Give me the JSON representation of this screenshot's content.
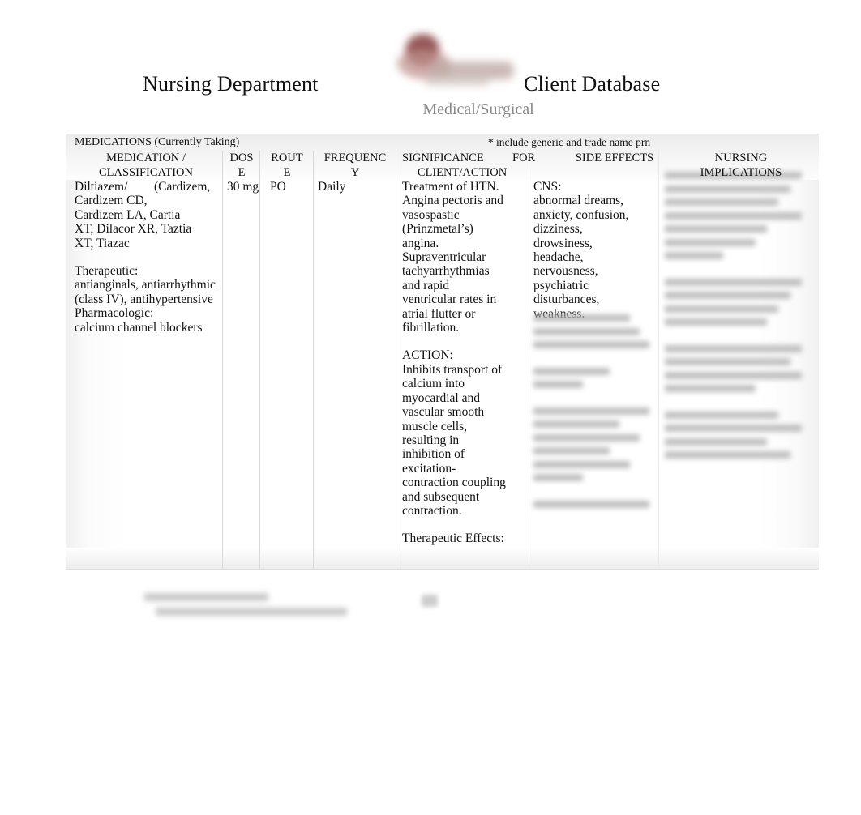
{
  "header": {
    "title_left": "Nursing Department",
    "title_right": "Client Database",
    "subtitle": "Medical/Surgical",
    "logo_name": "institution-logo-redacted"
  },
  "table": {
    "banner_label": "MEDICATIONS (Currently Taking)",
    "banner_note": "* include generic and trade name prn",
    "columns": [
      {
        "key": "medication",
        "header": "MEDICATION / CLASSIFICATION"
      },
      {
        "key": "dose",
        "header": "DOSE"
      },
      {
        "key": "route",
        "header": "ROUTE"
      },
      {
        "key": "frequency",
        "header": "FREQUENCY"
      },
      {
        "key": "significance",
        "header": "SIGNIFICANCE   FOR CLIENT/ACTION"
      },
      {
        "key": "side_effects",
        "header": "SIDE EFFECTS"
      },
      {
        "key": "nursing",
        "header": "NURSING IMPLICATIONS"
      }
    ],
    "headers": {
      "medication_l1": "MEDICATION /",
      "medication_l2": "CLASSIFICATION",
      "dose_l1": "DOS",
      "dose_l2": "E",
      "route_l1": "ROUT",
      "route_l2": "E",
      "frequency_l1": "FREQUENC",
      "frequency_l2": "Y",
      "significance_l1": "SIGNIFICANCE",
      "significance_for": "FOR",
      "significance_l2": "CLIENT/ACTION",
      "side_effects_l1": "SIDE EFFECTS",
      "nursing_l1": "NURSING",
      "nursing_l2": "IMPLICATIONS"
    },
    "row": {
      "medication_generic": "Diltiazem/",
      "medication_trade": "(Cardizem, Cardizem CD, Cardizem LA, Cartia XT, Dilacor XR, Taztia XT, Tiazac",
      "medication_therapeutic_label": "Therapeutic:",
      "medication_therapeutic_value": "antianginals, antiarrhythmic (class IV), antihypertensive",
      "medication_pharmacologic_label": "Pharmacologic:",
      "medication_pharmacologic_value": "calcium channel blockers",
      "dose": "30 mg",
      "route": "PO",
      "frequency": "Daily",
      "significance_p1": "Treatment of HTN. Angina pectoris and vasospastic (Prinzmetal’s) angina.",
      "significance_p2": "Supraventricular tachyarrhythmias and rapid ventricular rates in atrial flutter or fibrillation.",
      "significance_action_label": "ACTION:",
      "significance_action_text": "Inhibits transport of calcium into myocardial and vascular smooth muscle cells, resulting in inhibition of excitation-contraction coupling and subsequent contraction.",
      "significance_effects_label": "Therapeutic Effects:",
      "side_effects_cns_label": "CNS:",
      "side_effects_cns_text": "abnormal dreams, anxiety, confusion, dizziness, drowsiness,",
      "side_effects_cns_text2": "headache, nervousness, psychiatric disturbances, weakness.",
      "side_effects_redacted": "[redacted]",
      "nursing_redacted": "[redacted]"
    }
  },
  "footer": {
    "credit_redacted": "[redacted]",
    "page_number_redacted": "[redacted]"
  }
}
